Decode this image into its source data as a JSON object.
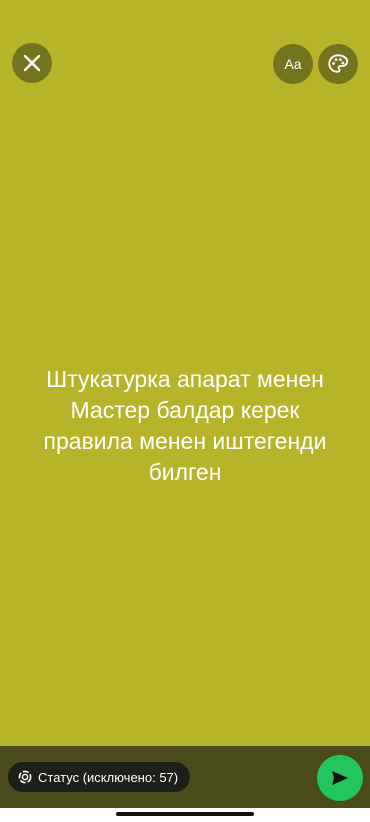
{
  "colors": {
    "background": "#b6b52a",
    "bottom_bar": "#4a4c1c",
    "send_button": "#22c55e",
    "chip": "#1d1f1a",
    "text": "#ffffff"
  },
  "toolbar": {
    "close_icon": "close-icon",
    "font_label": "Aa",
    "palette_icon": "palette-icon"
  },
  "status": {
    "text": "Штукатурка апарат менен\nМастер балдар керек\nправила менен иштегенди\nбилген"
  },
  "footer": {
    "privacy_label": "Статус (исключено: 57)",
    "privacy_icon": "status-ring-icon",
    "send_icon": "send-icon"
  }
}
